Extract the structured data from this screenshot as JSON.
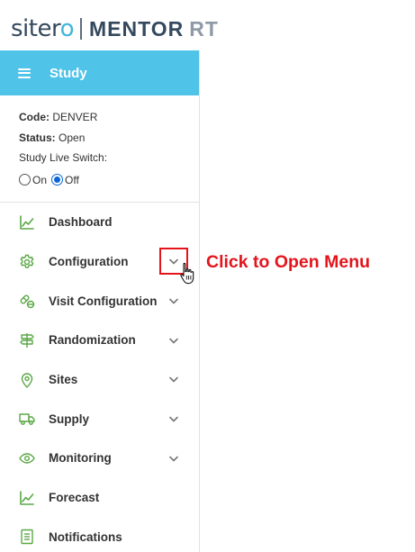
{
  "logo": {
    "brand": "siter",
    "brand_accent": "o",
    "product": "MENTOR",
    "product_suffix": "RT"
  },
  "study_bar": {
    "menu_icon": "hamburger-icon",
    "title": "Study"
  },
  "study_info": {
    "code_label": "Code:",
    "code_value": "DENVER",
    "status_label": "Status:",
    "status_value": "Open",
    "live_switch_label": "Study Live Switch:",
    "options": [
      {
        "label": "On",
        "checked": false
      },
      {
        "label": "Off",
        "checked": true
      }
    ]
  },
  "menu": [
    {
      "label": "Dashboard",
      "icon": "chart-line-icon",
      "expandable": false
    },
    {
      "label": "Configuration",
      "icon": "gear-icon",
      "expandable": true
    },
    {
      "label": "Visit Configuration",
      "icon": "pills-icon",
      "expandable": true
    },
    {
      "label": "Randomization",
      "icon": "signpost-icon",
      "expandable": true
    },
    {
      "label": "Sites",
      "icon": "map-pin-icon",
      "expandable": true
    },
    {
      "label": "Supply",
      "icon": "truck-icon",
      "expandable": true
    },
    {
      "label": "Monitoring",
      "icon": "eye-icon",
      "expandable": true
    },
    {
      "label": "Forecast",
      "icon": "chart-line-icon",
      "expandable": false
    },
    {
      "label": "Notifications",
      "icon": "document-icon",
      "expandable": false
    }
  ],
  "annotation": {
    "callout_text": "Click to Open Menu"
  },
  "colors": {
    "accent": "#4fc3e8",
    "icon_green": "#5aa846",
    "annotation_red": "#e3141c",
    "text": "#333333"
  }
}
